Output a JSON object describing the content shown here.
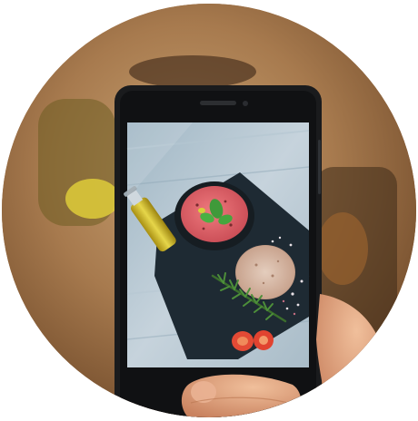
{
  "photo": {
    "subject": "hand-holding-smartphone-photographing-food",
    "colors": {
      "background_warm": "#a87b50",
      "slate": "#1e2a33",
      "soup": "#e0646a",
      "basil": "#3f9a3a",
      "olive_oil": "#c9b62a",
      "tomato": "#e34a35",
      "phone_body": "#1a1b1d",
      "skin": "#d9a07a"
    }
  }
}
